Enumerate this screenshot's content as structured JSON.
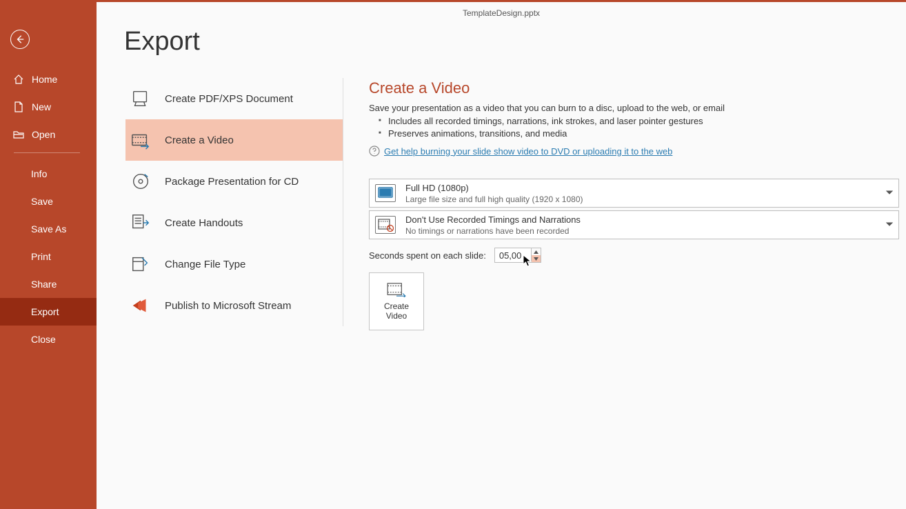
{
  "window": {
    "title": "TemplateDesign.pptx"
  },
  "sidebar": {
    "items": [
      {
        "label": "Home",
        "icon": "home-icon",
        "indent": false
      },
      {
        "label": "New",
        "icon": "new-icon",
        "indent": false
      },
      {
        "label": "Open",
        "icon": "open-icon",
        "indent": false
      },
      {
        "label": "Info",
        "icon": null,
        "indent": true
      },
      {
        "label": "Save",
        "icon": null,
        "indent": true
      },
      {
        "label": "Save As",
        "icon": null,
        "indent": true
      },
      {
        "label": "Print",
        "icon": null,
        "indent": true
      },
      {
        "label": "Share",
        "icon": null,
        "indent": true
      },
      {
        "label": "Export",
        "icon": null,
        "indent": true,
        "selected": true
      },
      {
        "label": "Close",
        "icon": null,
        "indent": true
      }
    ]
  },
  "page": {
    "title": "Export"
  },
  "export_options": [
    {
      "label": "Create PDF/XPS Document"
    },
    {
      "label": "Create a Video",
      "selected": true
    },
    {
      "label": "Package Presentation for CD"
    },
    {
      "label": "Create Handouts"
    },
    {
      "label": "Change File Type"
    },
    {
      "label": "Publish to Microsoft Stream"
    }
  ],
  "details": {
    "heading": "Create a Video",
    "lead": "Save your presentation as a video that you can burn to a disc, upload to the web, or email",
    "bullets": [
      "Includes all recorded timings, narrations, ink strokes, and laser pointer gestures",
      "Preserves animations, transitions, and media"
    ],
    "help_link": "Get help burning your slide show video to DVD or uploading it to the web",
    "combo1": {
      "title": "Full HD (1080p)",
      "sub": "Large file size and full high quality (1920 x 1080)"
    },
    "combo2": {
      "title": "Don't Use Recorded Timings and Narrations",
      "sub": "No timings or narrations have been recorded"
    },
    "seconds_label": "Seconds spent on each slide:",
    "seconds_value": "05,00",
    "create_btn": "Create\nVideo"
  }
}
